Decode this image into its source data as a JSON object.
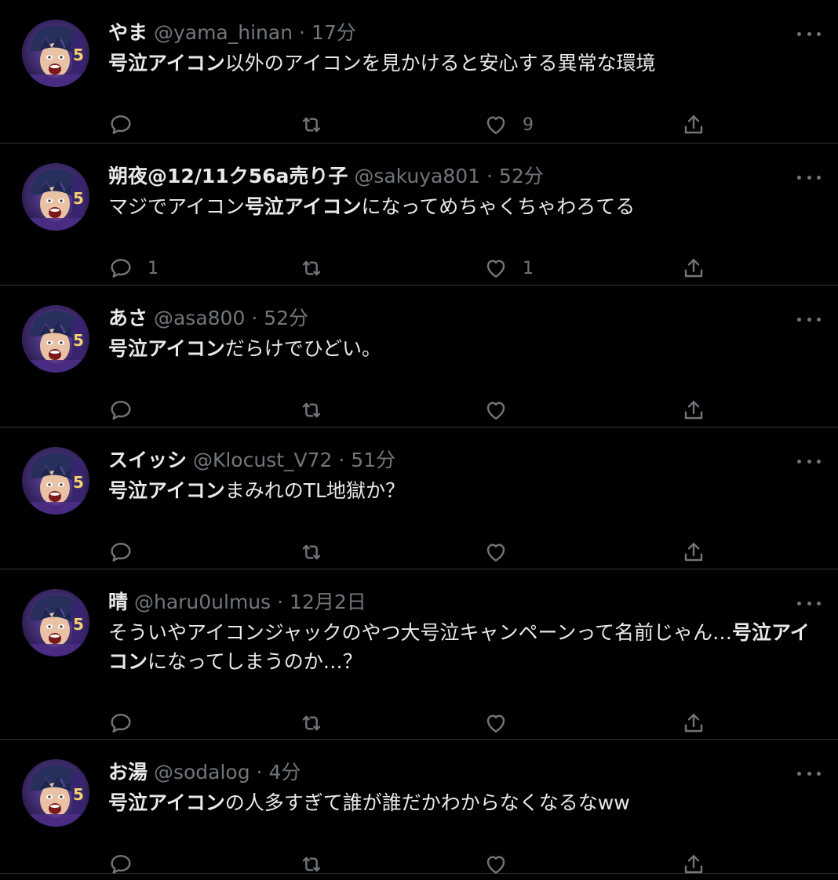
{
  "colors": {
    "background": "#000000",
    "text": "#e7e9ea",
    "secondary": "#71767b",
    "divider": "#2f3336"
  },
  "tweets": [
    {
      "name": "やま",
      "handle": "@yama_hinan",
      "dot": "·",
      "time": "17分",
      "segments": [
        {
          "t": "号泣アイコン",
          "b": true
        },
        {
          "t": "以外のアイコンを見かけると安心する異常な環境",
          "b": false
        }
      ],
      "reply_count": "",
      "retweet_count": "",
      "like_count": "9"
    },
    {
      "name": "朔夜@12/11ク56a売り子",
      "handle": "@sakuya801",
      "dot": "·",
      "time": "52分",
      "segments": [
        {
          "t": "マジでアイコン",
          "b": false
        },
        {
          "t": "号泣アイコン",
          "b": true
        },
        {
          "t": "になってめちゃくちゃわろてる",
          "b": false
        }
      ],
      "reply_count": "1",
      "retweet_count": "",
      "like_count": "1"
    },
    {
      "name": "あさ",
      "handle": "@asa800",
      "dot": "·",
      "time": "52分",
      "segments": [
        {
          "t": "号泣アイコン",
          "b": true
        },
        {
          "t": "だらけでひどい。",
          "b": false
        }
      ],
      "reply_count": "",
      "retweet_count": "",
      "like_count": ""
    },
    {
      "name": "スイッシ",
      "handle": "@Klocust_V72",
      "dot": "·",
      "time": "51分",
      "segments": [
        {
          "t": "号泣アイコン",
          "b": true
        },
        {
          "t": "まみれのTL地獄か？",
          "b": false
        }
      ],
      "reply_count": "",
      "retweet_count": "",
      "like_count": ""
    },
    {
      "name": "晴",
      "handle": "@haru0ulmus",
      "dot": "·",
      "time": "12月2日",
      "segments": [
        {
          "t": "そういやアイコンジャックのやつ大号泣キャンペーンって名前じゃん…",
          "b": false
        },
        {
          "t": "号泣アイコン",
          "b": true
        },
        {
          "t": "になってしまうのか…？",
          "b": false
        }
      ],
      "reply_count": "",
      "retweet_count": "",
      "like_count": ""
    },
    {
      "name": "お湯",
      "handle": "@sodalog",
      "dot": "·",
      "time": "4分",
      "segments": [
        {
          "t": "号泣アイコン",
          "b": true
        },
        {
          "t": "の人多すぎて誰が誰だかわからなくなるなww",
          "b": false
        }
      ],
      "reply_count": "",
      "retweet_count": "",
      "like_count": ""
    }
  ]
}
